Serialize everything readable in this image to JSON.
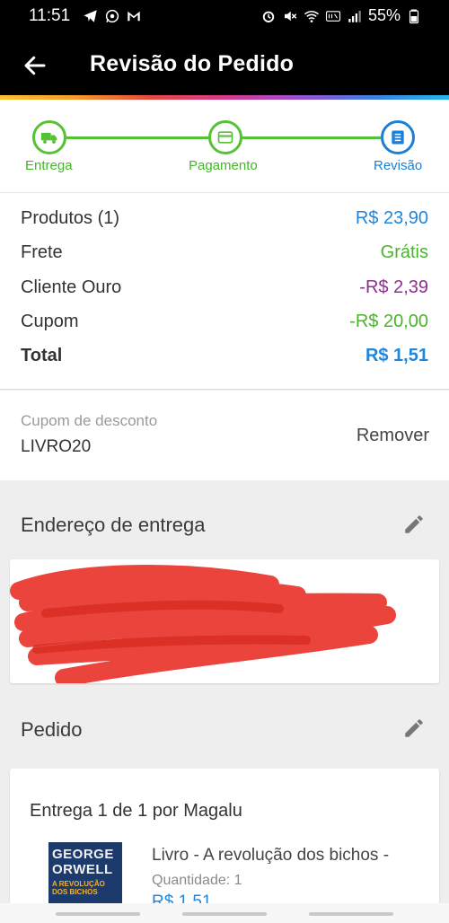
{
  "status_bar": {
    "time": "11:51",
    "battery": "55%",
    "left_icons": [
      "telegram-icon",
      "whatsapp-icon",
      "gmail-icon"
    ],
    "right_icons": [
      "alarm-icon",
      "mute-icon",
      "wifi-icon",
      "volte-icon",
      "signal-icon",
      "battery-icon"
    ]
  },
  "header": {
    "title": "Revisão do Pedido",
    "back_icon": "arrow-back-icon"
  },
  "stepper": {
    "steps": [
      {
        "label": "Entrega",
        "icon": "truck-icon",
        "state": "done"
      },
      {
        "label": "Pagamento",
        "icon": "card-icon",
        "state": "done"
      },
      {
        "label": "Revisão",
        "icon": "list-icon",
        "state": "current"
      }
    ],
    "colors": {
      "done": "#55c134",
      "current": "#1b7fd6"
    }
  },
  "summary": {
    "products_label": "Produtos (1)",
    "products_value": "R$ 23,90",
    "shipping_label": "Frete",
    "shipping_value": "Grátis",
    "gold_label": "Cliente Ouro",
    "gold_value": "-R$ 2,39",
    "coupon_label": "Cupom",
    "coupon_value": "-R$ 20,00",
    "total_label": "Total",
    "total_value": "R$ 1,51"
  },
  "coupon": {
    "label": "Cupom de desconto",
    "code": "LIVRO20",
    "remove_label": "Remover"
  },
  "address_section": {
    "title": "Endereço de entrega",
    "edit_icon": "pencil-icon",
    "redacted": true
  },
  "order_section": {
    "title": "Pedido",
    "edit_icon": "pencil-icon",
    "delivery_label": "Entrega 1 de 1 por Magalu",
    "item": {
      "name": "Livro - A revolução dos bichos -",
      "quantity_label": "Quantidade:  1",
      "price": "R$ 1,51",
      "cover_text": [
        "GEORGE",
        "ORWELL",
        "A REVOLUÇÃO",
        "DOS BICHOS"
      ]
    }
  }
}
